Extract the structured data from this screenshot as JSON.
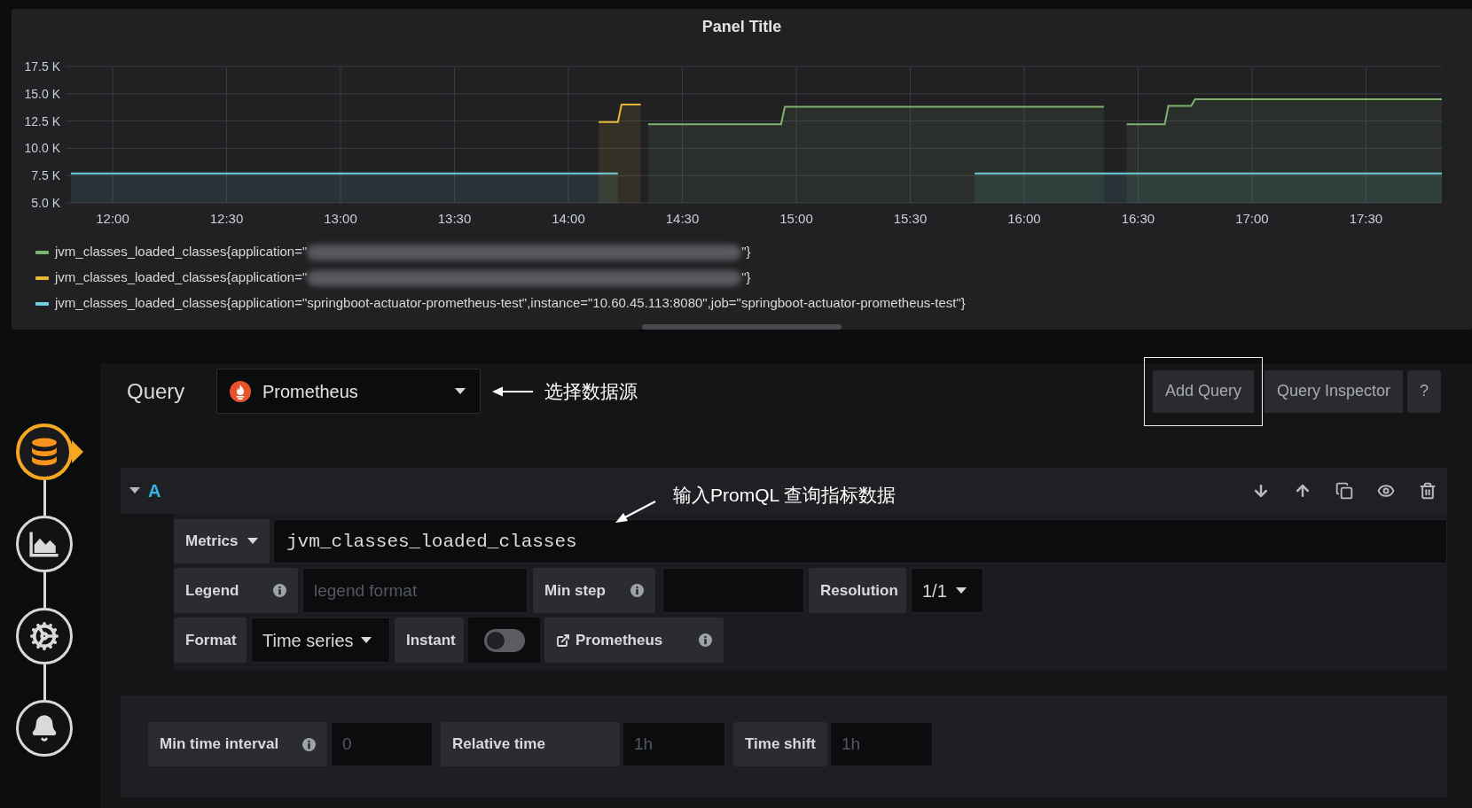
{
  "panel": {
    "title": "Panel Title",
    "chart_data": {
      "type": "area",
      "grid": true,
      "x": [
        11.817,
        14.133,
        14.217,
        14.233,
        14.317,
        14.35,
        14.933,
        14.95,
        15.783,
        16.35,
        16.367,
        16.45,
        16.617,
        16.633,
        16.733,
        16.75,
        17.833
      ],
      "xlim": [
        11.817,
        17.833
      ],
      "ylim": [
        5000,
        17500
      ],
      "xticks": [
        {
          "value": 12,
          "label": "12:00"
        },
        {
          "value": 12.5,
          "label": "12:30"
        },
        {
          "value": 13,
          "label": "13:00"
        },
        {
          "value": 13.5,
          "label": "13:30"
        },
        {
          "value": 14,
          "label": "14:00"
        },
        {
          "value": 14.5,
          "label": "14:30"
        },
        {
          "value": 15,
          "label": "15:00"
        },
        {
          "value": 15.5,
          "label": "15:30"
        },
        {
          "value": 16,
          "label": "16:00"
        },
        {
          "value": 16.5,
          "label": "16:30"
        },
        {
          "value": 17,
          "label": "17:00"
        },
        {
          "value": 17.5,
          "label": "17:30"
        }
      ],
      "yticks": [
        {
          "value": 5000,
          "label": "5.0 K"
        },
        {
          "value": 7500,
          "label": "7.5 K"
        },
        {
          "value": 10000,
          "label": "10.0 K"
        },
        {
          "value": 12500,
          "label": "12.5 K"
        },
        {
          "value": 15000,
          "label": "15.0 K"
        },
        {
          "value": 17500,
          "label": "17.5 K"
        }
      ],
      "series": [
        {
          "color": "#7eb26d",
          "values": [
            null,
            null,
            null,
            null,
            null,
            12200,
            12200,
            13800,
            13800,
            13800,
            null,
            12200,
            12200,
            13900,
            13900,
            14500,
            14500
          ]
        },
        {
          "color": "#eab839",
          "values": [
            null,
            12400,
            12400,
            14000,
            14000,
            null,
            null,
            null,
            null,
            null,
            null,
            null,
            null,
            null,
            null,
            null,
            null
          ]
        },
        {
          "color": "#6ed0e0",
          "values": [
            7700,
            7700,
            7700,
            null,
            null,
            null,
            null,
            null,
            7700,
            7700,
            7700,
            7700,
            7700,
            7700,
            7700,
            7700,
            7700
          ]
        }
      ]
    },
    "legend": [
      {
        "color": "#7eb26d",
        "text": "jvm_classes_loaded_classes{application=\"",
        "redacted": true,
        "suffix": "\"}"
      },
      {
        "color": "#eab839",
        "text": "jvm_classes_loaded_classes{application=\"",
        "redacted": true,
        "suffix": "\"}"
      },
      {
        "color": "#6ed0e0",
        "text": "jvm_classes_loaded_classes{application=\"springboot-actuator-prometheus-test\",instance=\"10.60.45.113:8080\",job=\"springboot-actuator-prometheus-test\"}",
        "redacted": false
      }
    ]
  },
  "sidebar": {
    "items": [
      {
        "kind": "database",
        "selected": true
      },
      {
        "kind": "chart",
        "selected": false
      },
      {
        "kind": "settings",
        "selected": false
      },
      {
        "kind": "alert",
        "selected": false
      }
    ]
  },
  "query_bar": {
    "title": "Query",
    "datasource": "Prometheus",
    "annotation": "选择数据源",
    "buttons": [
      {
        "label": "Add Query",
        "outlined": true
      },
      {
        "label": "Query Inspector",
        "outlined": false
      },
      {
        "label": "?",
        "outlined": false
      }
    ]
  },
  "queries": [
    {
      "ref": "A",
      "expanded": true,
      "annotation": "输入PromQL 查询指标数据",
      "metrics_label": "Metrics",
      "expr": "jvm_classes_loaded_classes",
      "legend": {
        "label": "Legend",
        "placeholder": "legend format"
      },
      "min_step": {
        "label": "Min step"
      },
      "resolution": {
        "label": "Resolution",
        "value": "1/1"
      },
      "format": {
        "label": "Format",
        "value": "Time series"
      },
      "instant": {
        "label": "Instant",
        "on": false
      },
      "link": {
        "label": "Prometheus"
      }
    }
  ],
  "options": {
    "min_time_interval": {
      "label": "Min time interval",
      "placeholder": "0"
    },
    "relative_time": {
      "label": "Relative time",
      "placeholder": "1h"
    },
    "time_shift": {
      "label": "Time shift",
      "placeholder": "1h"
    }
  }
}
